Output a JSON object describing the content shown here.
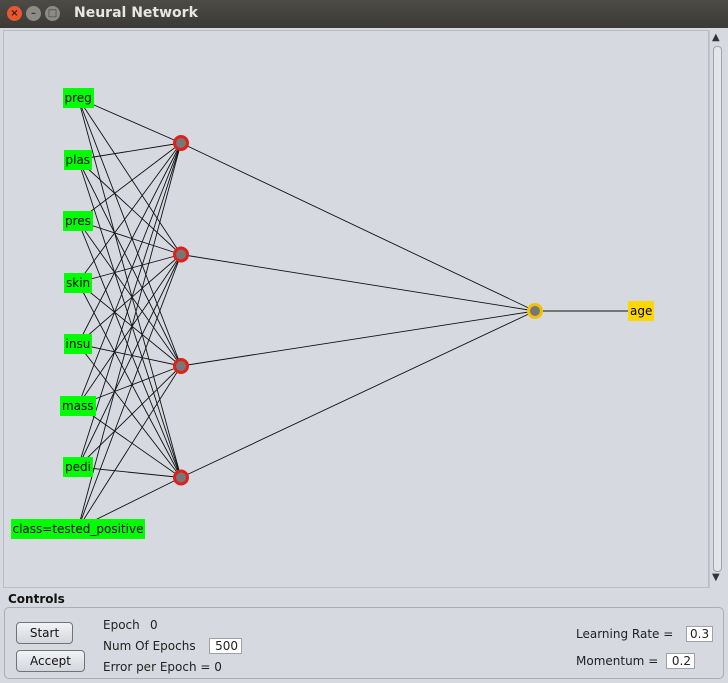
{
  "window": {
    "title": "Neural Network"
  },
  "network": {
    "inputs": [
      "preg",
      "plas",
      "pres",
      "skin",
      "insu",
      "mass",
      "pedi",
      "class=tested_positive"
    ],
    "hidden_node_count": 4,
    "output": "age",
    "colors": {
      "input_bg": "#00ff00",
      "output_bg": "#ffd700",
      "hidden_node": "#e0201b",
      "output_node": "#f2c200",
      "node_fill": "#777777"
    }
  },
  "controls": {
    "title": "Controls",
    "start_label": "Start",
    "accept_label": "Accept",
    "epoch_label": "Epoch",
    "epoch_value": "0",
    "num_epochs_label": "Num Of Epochs",
    "num_epochs_value": "500",
    "error_label": "Error per Epoch = 0",
    "learning_rate_label": "Learning Rate =",
    "learning_rate_value": "0.3",
    "momentum_label": "Momentum =",
    "momentum_value": "0.2"
  }
}
